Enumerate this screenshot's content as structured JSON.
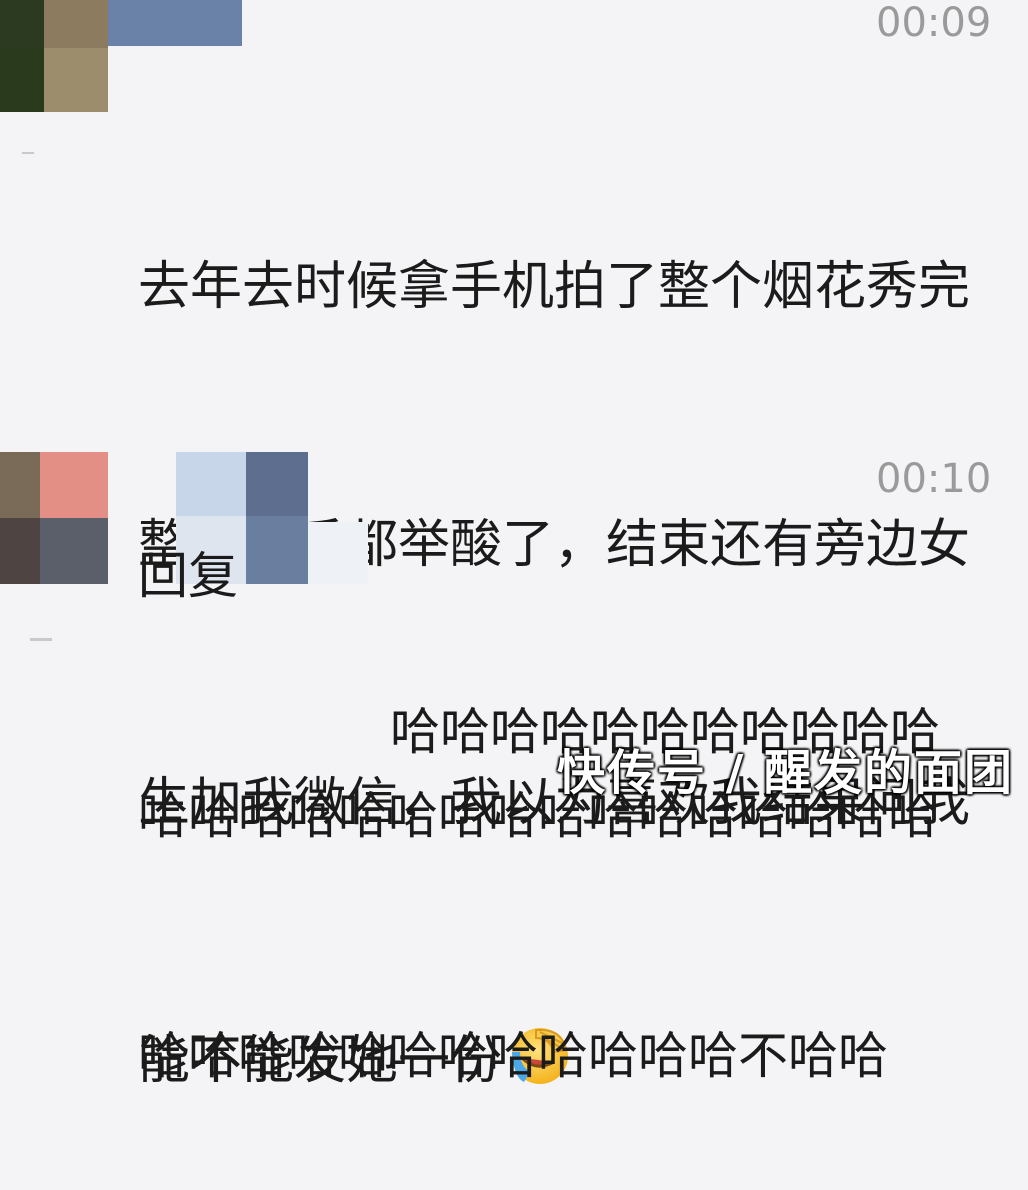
{
  "comments": [
    {
      "time": "00:09",
      "lines": [
        "去年去时候拿手机拍了整个烟花秀完",
        "整版，手都举酸了，结束还有旁边女",
        "生加我微信，我以为喜欢我结果问我",
        "能不能发她一份"
      ],
      "emoji": "facepalm-laughing-emoji"
    },
    {
      "time": "00:10",
      "reply_prefix": "回复",
      "lines": [
        "哈哈哈哈哈哈哈哈哈哈哈",
        "哈哈哈哈哈哈哈哈哈哈哈哈哈哈哈哈",
        "哈哈哈哈哈哈哈哈哈哈哈哈不哈哈"
      ]
    }
  ],
  "watermark": "快传号 / 醒发的面团"
}
